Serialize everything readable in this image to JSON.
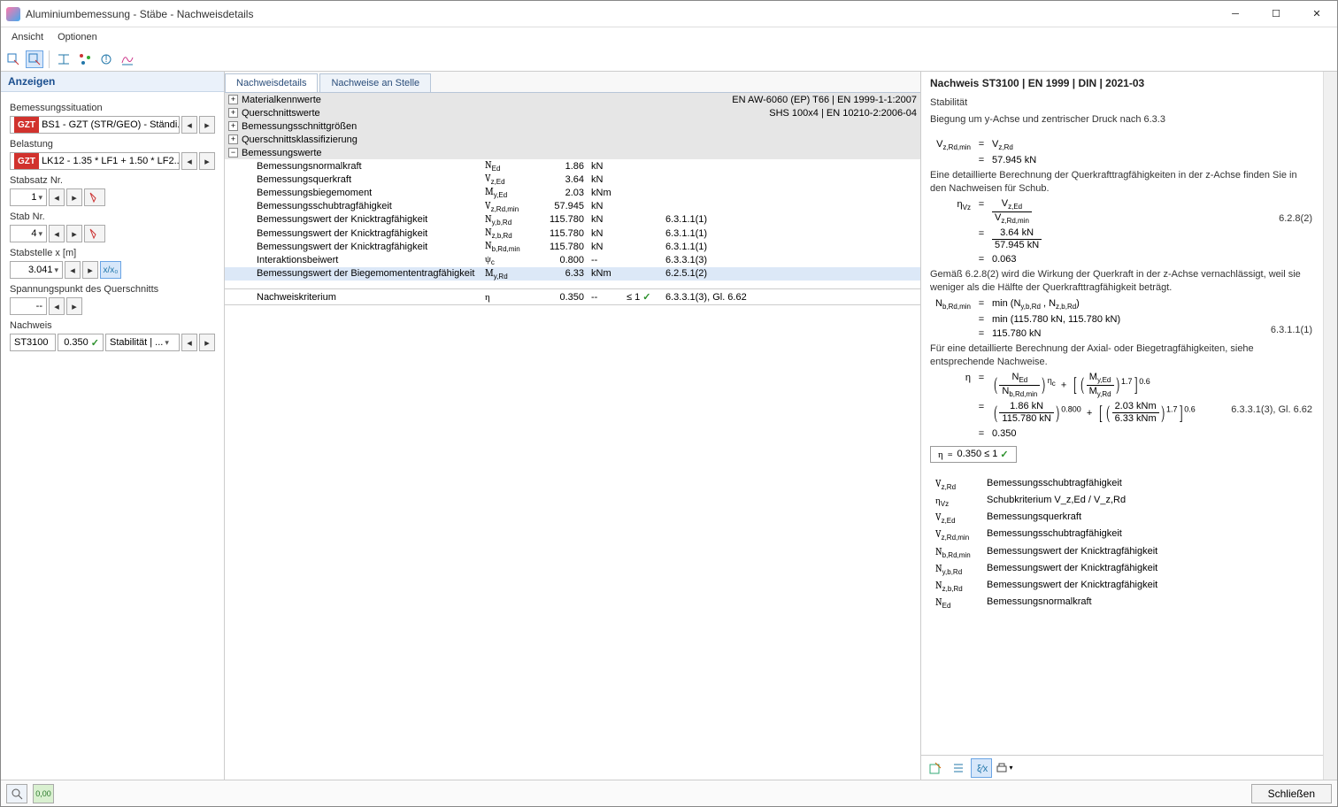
{
  "window": {
    "title": "Aluminiumbemessung - Stäbe - Nachweisdetails"
  },
  "menu": {
    "view": "Ansicht",
    "options": "Optionen"
  },
  "left": {
    "header": "Anzeigen",
    "situation_lbl": "Bemessungssituation",
    "situation_badge": "GZT",
    "situation_val": "BS1 - GZT (STR/GEO) - Ständi...",
    "load_lbl": "Belastung",
    "load_badge": "GZT",
    "load_val": "LK12 - 1.35 * LF1 + 1.50 * LF2...",
    "set_lbl": "Stabsatz Nr.",
    "set_val": "1",
    "member_lbl": "Stab Nr.",
    "member_val": "4",
    "pos_lbl": "Stabstelle x [m]",
    "pos_val": "3.041",
    "pos_icon": "x/x₀",
    "stress_lbl": "Spannungspunkt des Querschnitts",
    "stress_val": "--",
    "proof_lbl": "Nachweis",
    "proof_id": "ST3100",
    "proof_ratio": "0.350",
    "proof_cat": "Stabilität | ..."
  },
  "tabs": {
    "a": "Nachweisdetails",
    "b": "Nachweise an Stelle"
  },
  "sections": {
    "mat": "Materialkennwerte",
    "mat_r": "EN AW-6060 (EP) T66 | EN 1999-1-1:2007",
    "cs": "Querschnittswerte",
    "cs_r": "SHS 100x4 | EN 10210-2:2006-04",
    "des": "Bemessungsschnittgrößen",
    "cls": "Querschnittsklassifizierung",
    "val": "Bemessungswerte"
  },
  "rows": [
    {
      "n": "Bemessungsnormalkraft",
      "s": "N_Ed",
      "v": "1.86",
      "u": "kN",
      "r": ""
    },
    {
      "n": "Bemessungsquerkraft",
      "s": "V_z,Ed",
      "v": "3.64",
      "u": "kN",
      "r": ""
    },
    {
      "n": "Bemessungsbiegemoment",
      "s": "M_y,Ed",
      "v": "2.03",
      "u": "kNm",
      "r": ""
    },
    {
      "n": "Bemessungsschubtragfähigkeit",
      "s": "V_z,Rd,min",
      "v": "57.945",
      "u": "kN",
      "r": ""
    },
    {
      "n": "Bemessungswert der Knicktragfähigkeit",
      "s": "N_y,b,Rd",
      "v": "115.780",
      "u": "kN",
      "r": "6.3.1.1(1)"
    },
    {
      "n": "Bemessungswert der Knicktragfähigkeit",
      "s": "N_z,b,Rd",
      "v": "115.780",
      "u": "kN",
      "r": "6.3.1.1(1)"
    },
    {
      "n": "Bemessungswert der Knicktragfähigkeit",
      "s": "N_b,Rd,min",
      "v": "115.780",
      "u": "kN",
      "r": "6.3.1.1(1)"
    },
    {
      "n": "Interaktionsbeiwert",
      "s": "ψ_c",
      "v": "0.800",
      "u": "--",
      "r": "6.3.3.1(3)"
    },
    {
      "n": "Bemessungswert der Biegemomententragfähigkeit",
      "s": "M_y,Rd",
      "v": "6.33",
      "u": "kNm",
      "r": "6.2.5.1(2)"
    }
  ],
  "crit": {
    "name": "Nachweiskriterium",
    "sym": "η",
    "val": "0.350",
    "u": "--",
    "lim": "≤ 1",
    "ref": "6.3.3.1(3), Gl. 6.62"
  },
  "detail": {
    "title": "Nachweis ST3100 | EN 1999 | DIN | 2021-03",
    "h1": "Stabilität",
    "h2": "Biegung um y-Achse und zentrischer Druck nach 6.3.3",
    "vz_l": "V_z,Rd,min",
    "vz_r": "V_z,Rd",
    "vz_v": "57.945 kN",
    "p1": "Eine detaillierte Berechnung der Querkrafttragfähigkeiten in der z-Achse finden Sie in den Nachweisen für Schub.",
    "tag1": "6.2.8(2)",
    "eta_sym": "η_Vz",
    "eta_ft": "V_z,Ed",
    "eta_fb": "V_z,Rd,min",
    "eta_nt": "3.64 kN",
    "eta_nb": "57.945 kN",
    "eta_v": "0.063",
    "p2": "Gemäß 6.2.8(2) wird die Wirkung der Querkraft in der z-Achse vernachlässigt, weil sie weniger als die Hälfte der Querkrafttragfähigkeit beträgt.",
    "tag2": "6.3.1.1(1)",
    "nb_l": "N_b,Rd,min",
    "nb_r": "min (N_y,b,Rd , N_z,b,Rd)",
    "nb_n": "min (115.780 kN, 115.780 kN)",
    "nb_v": "115.780 kN",
    "p3": "Für eine detaillierte Berechnung der Axial- oder Biegetragfähigkeiten, siehe entsprechende Nachweise.",
    "tag3": "6.3.3.1(3), Gl. 6.62",
    "fin_sym": "η",
    "f1t": "N_Ed",
    "f1b": "N_b,Rd,min",
    "e1": "η_c",
    "f2t": "M_y,Ed",
    "f2b": "M_y,Rd",
    "e2": "1.7",
    "e3": "0.6",
    "n1t": "1.86 kN",
    "n1b": "115.780 kN",
    "ne1": "0.800",
    "n2t": "2.03 kNm",
    "n2b": "6.33 kNm",
    "fin_v": "0.350",
    "fin_box": "0.350  ≤ 1",
    "defs": [
      {
        "s": "V_z,Rd",
        "d": "Bemessungsschubtragfähigkeit"
      },
      {
        "s": "η_Vz",
        "d": "Schubkriterium V_z,Ed / V_z,Rd"
      },
      {
        "s": "V_z,Ed",
        "d": "Bemessungsquerkraft"
      },
      {
        "s": "V_z,Rd,min",
        "d": "Bemessungsschubtragfähigkeit"
      },
      {
        "s": "N_b,Rd,min",
        "d": "Bemessungswert der Knicktragfähigkeit"
      },
      {
        "s": "N_y,b,Rd",
        "d": "Bemessungswert der Knicktragfähigkeit"
      },
      {
        "s": "N_z,b,Rd",
        "d": "Bemessungswert der Knicktragfähigkeit"
      },
      {
        "s": "N_Ed",
        "d": "Bemessungsnormalkraft"
      }
    ]
  },
  "footer": {
    "close": "Schließen"
  }
}
